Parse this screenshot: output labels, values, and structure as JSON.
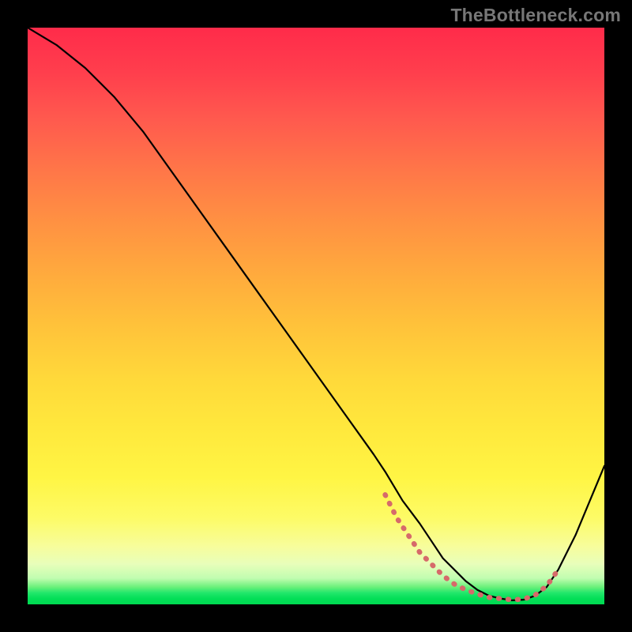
{
  "watermark": "TheBottleneck.com",
  "colors": {
    "frame_border": "#000000",
    "curve": "#000000",
    "dotted_accent": "#d66a6a"
  },
  "chart_data": {
    "type": "line",
    "title": "",
    "xlabel": "",
    "ylabel": "",
    "xlim": [
      0,
      100
    ],
    "ylim": [
      0,
      100
    ],
    "grid": false,
    "legend": false,
    "series": [
      {
        "name": "main-curve",
        "x": [
          0,
          5,
          10,
          15,
          20,
          25,
          30,
          35,
          40,
          45,
          50,
          55,
          60,
          62,
          65,
          68,
          70,
          72,
          74,
          76,
          78,
          80,
          82,
          84,
          86,
          88,
          90,
          92,
          95,
          100
        ],
        "y": [
          100,
          97,
          93,
          88,
          82,
          75,
          68,
          61,
          54,
          47,
          40,
          33,
          26,
          23,
          18,
          14,
          11,
          8,
          6,
          4,
          2.5,
          1.5,
          1,
          0.7,
          0.8,
          1.5,
          3,
          6,
          12,
          24
        ]
      },
      {
        "name": "dotted-accent",
        "x": [
          62,
          64,
          66,
          68,
          70,
          72,
          74,
          76,
          78,
          80,
          82,
          84,
          86,
          88,
          90,
          92
        ],
        "y": [
          19,
          15,
          12,
          9,
          7,
          5,
          3.5,
          2.5,
          1.8,
          1.2,
          1,
          0.8,
          0.9,
          1.6,
          3.2,
          6
        ]
      }
    ]
  }
}
